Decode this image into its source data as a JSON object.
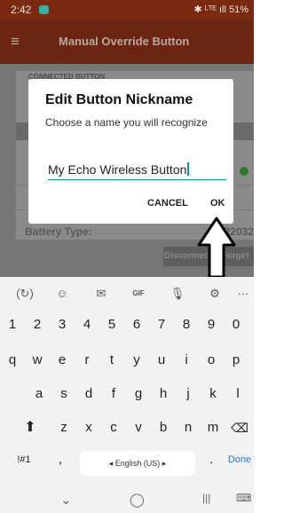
{
  "status_bar": {
    "time": "2:42",
    "indicators": "✱ ᴸᵀᴱ ıll 51%"
  },
  "app_bar": {
    "title": "Manual Override Button",
    "menu_icon": "hamburger-icon"
  },
  "background": {
    "section_label": "CONNECTED BUTTON",
    "battery_label": "Battery Type:",
    "battery_value": "CR2032",
    "disconnect_label": "Disconnect",
    "forget_label": "Forget"
  },
  "dialog": {
    "title": "Edit Button Nickname",
    "subtitle": "Choose a name you will recognize",
    "input_value": "My Echo Wireless Button",
    "cancel_label": "CANCEL",
    "ok_label": "OK",
    "accent_color": "#1a8a8a"
  },
  "keyboard": {
    "toolbar": [
      "(↻)",
      "☺",
      "✉",
      "GIF",
      "🎙",
      "⚙",
      "···"
    ],
    "number_row": [
      "1",
      "2",
      "3",
      "4",
      "5",
      "6",
      "7",
      "8",
      "9",
      "0"
    ],
    "row_q": [
      "q",
      "w",
      "e",
      "r",
      "t",
      "y",
      "u",
      "i",
      "o",
      "p"
    ],
    "row_a": [
      "a",
      "s",
      "d",
      "f",
      "g",
      "h",
      "j",
      "k",
      "l"
    ],
    "row_z": [
      "z",
      "x",
      "c",
      "v",
      "b",
      "n",
      "m"
    ],
    "shift": "⬆",
    "backspace": "⌫",
    "symbols": "!#1",
    "comma": ",",
    "space_label": "◂ English (US) ▸",
    "period": ".",
    "done": "Done"
  },
  "nav_bar": {
    "back": "⌄",
    "home": "◯",
    "recents": "|||",
    "keyboard": "⌨"
  }
}
